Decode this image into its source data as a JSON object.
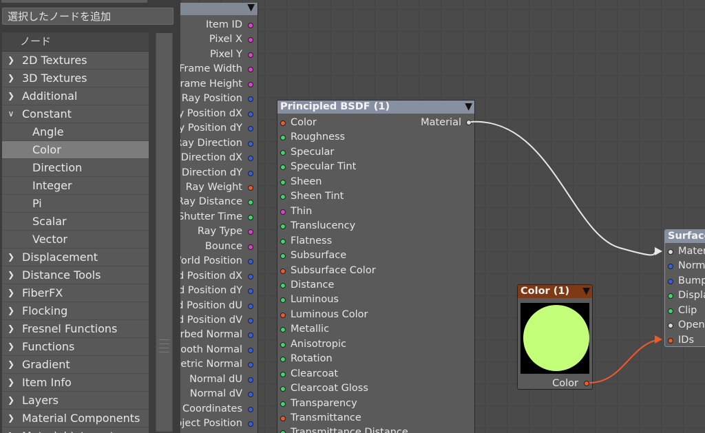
{
  "colors": {
    "socket_magenta": "#e040d0",
    "socket_blue": "#3a5ee0",
    "socket_orange": "#f05a28",
    "socket_green": "#3ed86a",
    "socket_white": "#dcdcdc",
    "wire_white": "#e8e8e8",
    "wire_orange": "#f05a28",
    "picked_color": "#c3ff78"
  },
  "left_panel": {
    "add_button_label": "選択したノードを追加",
    "list_header": "ノード",
    "items": [
      {
        "label": "2D Textures",
        "level": "category",
        "expanded": false
      },
      {
        "label": "3D Textures",
        "level": "category",
        "expanded": false
      },
      {
        "label": "Additional",
        "level": "category",
        "expanded": false
      },
      {
        "label": "Constant",
        "level": "category",
        "expanded": true
      },
      {
        "label": "Angle",
        "level": "child"
      },
      {
        "label": "Color",
        "level": "child",
        "selected": true
      },
      {
        "label": "Direction",
        "level": "child"
      },
      {
        "label": "Integer",
        "level": "child"
      },
      {
        "label": "Pi",
        "level": "child"
      },
      {
        "label": "Scalar",
        "level": "child"
      },
      {
        "label": "Vector",
        "level": "child"
      },
      {
        "label": "Displacement",
        "level": "category",
        "expanded": false
      },
      {
        "label": "Distance Tools",
        "level": "category",
        "expanded": false
      },
      {
        "label": "FiberFX",
        "level": "category",
        "expanded": false
      },
      {
        "label": "Flocking",
        "level": "category",
        "expanded": false
      },
      {
        "label": "Fresnel Functions",
        "level": "category",
        "expanded": false
      },
      {
        "label": "Functions",
        "level": "category",
        "expanded": false
      },
      {
        "label": "Gradient",
        "level": "category",
        "expanded": false
      },
      {
        "label": "Item Info",
        "level": "category",
        "expanded": false
      },
      {
        "label": "Layers",
        "level": "category",
        "expanded": false
      },
      {
        "label": "Material Components",
        "level": "category",
        "expanded": false
      },
      {
        "label": "Material Integrators",
        "level": "category",
        "expanded": false
      }
    ]
  },
  "ray_node": {
    "outputs": [
      {
        "label": "Item ID",
        "socket": "magenta"
      },
      {
        "label": "Pixel X",
        "socket": "magenta"
      },
      {
        "label": "Pixel Y",
        "socket": "magenta"
      },
      {
        "label": "Frame Width",
        "socket": "magenta"
      },
      {
        "label": "Frame Height",
        "socket": "magenta"
      },
      {
        "label": "Ray Position",
        "socket": "blue"
      },
      {
        "label": "Ray Position dX",
        "socket": "blue"
      },
      {
        "label": "Ray Position dY",
        "socket": "blue"
      },
      {
        "label": "Ray Direction",
        "socket": "blue"
      },
      {
        "label": "Ray Direction dX",
        "socket": "blue"
      },
      {
        "label": "Ray Direction dY",
        "socket": "blue"
      },
      {
        "label": "Ray Weight",
        "socket": "orange"
      },
      {
        "label": "Ray Distance",
        "socket": "green"
      },
      {
        "label": "Shutter Time",
        "socket": "green"
      },
      {
        "label": "Ray Type",
        "socket": "magenta"
      },
      {
        "label": "Bounce",
        "socket": "magenta"
      },
      {
        "label": "World Position",
        "socket": "blue"
      },
      {
        "label": "World Position dX",
        "socket": "blue"
      },
      {
        "label": "World Position dY",
        "socket": "blue"
      },
      {
        "label": "World Position dU",
        "socket": "blue"
      },
      {
        "label": "World Position dV",
        "socket": "blue"
      },
      {
        "label": "Perturbed Normal",
        "socket": "blue"
      },
      {
        "label": "Smooth Normal",
        "socket": "blue"
      },
      {
        "label": "Geometric Normal",
        "socket": "blue"
      },
      {
        "label": "Normal dU",
        "socket": "blue"
      },
      {
        "label": "Normal dV",
        "socket": "blue"
      },
      {
        "label": "Coordinates",
        "socket": "blue"
      },
      {
        "label": "Object Position",
        "socket": "blue"
      }
    ]
  },
  "bsdf_node": {
    "title": "Principled BSDF (1)",
    "output": {
      "label": "Material",
      "socket": "white"
    },
    "inputs": [
      {
        "label": "Color",
        "socket": "orange"
      },
      {
        "label": "Roughness",
        "socket": "green"
      },
      {
        "label": "Specular",
        "socket": "green"
      },
      {
        "label": "Specular Tint",
        "socket": "green"
      },
      {
        "label": "Sheen",
        "socket": "green"
      },
      {
        "label": "Sheen Tint",
        "socket": "green"
      },
      {
        "label": "Thin",
        "socket": "magenta"
      },
      {
        "label": "Translucency",
        "socket": "green"
      },
      {
        "label": "Flatness",
        "socket": "green"
      },
      {
        "label": "Subsurface",
        "socket": "green"
      },
      {
        "label": "Subsurface Color",
        "socket": "orange"
      },
      {
        "label": "Distance",
        "socket": "green"
      },
      {
        "label": "Luminous",
        "socket": "green"
      },
      {
        "label": "Luminous Color",
        "socket": "orange"
      },
      {
        "label": "Metallic",
        "socket": "green"
      },
      {
        "label": "Anisotropic",
        "socket": "green"
      },
      {
        "label": "Rotation",
        "socket": "green"
      },
      {
        "label": "Clearcoat",
        "socket": "green"
      },
      {
        "label": "Clearcoat Gloss",
        "socket": "green"
      },
      {
        "label": "Transparency",
        "socket": "green"
      },
      {
        "label": "Transmittance",
        "socket": "orange"
      },
      {
        "label": "Transmittance Distance",
        "socket": "green"
      }
    ]
  },
  "color_node": {
    "title": "Color (1)",
    "output": {
      "label": "Color",
      "socket": "orange"
    }
  },
  "surface_node": {
    "title": "Surface",
    "inputs": [
      {
        "label": "Material",
        "socket": "white"
      },
      {
        "label": "Normal",
        "socket": "blue"
      },
      {
        "label": "Bump",
        "socket": "blue"
      },
      {
        "label": "Displacement",
        "socket": "green"
      },
      {
        "label": "Clip",
        "socket": "green"
      },
      {
        "label": "OpenGL",
        "socket": "white"
      },
      {
        "label": "IDs",
        "socket": "orange"
      }
    ]
  }
}
